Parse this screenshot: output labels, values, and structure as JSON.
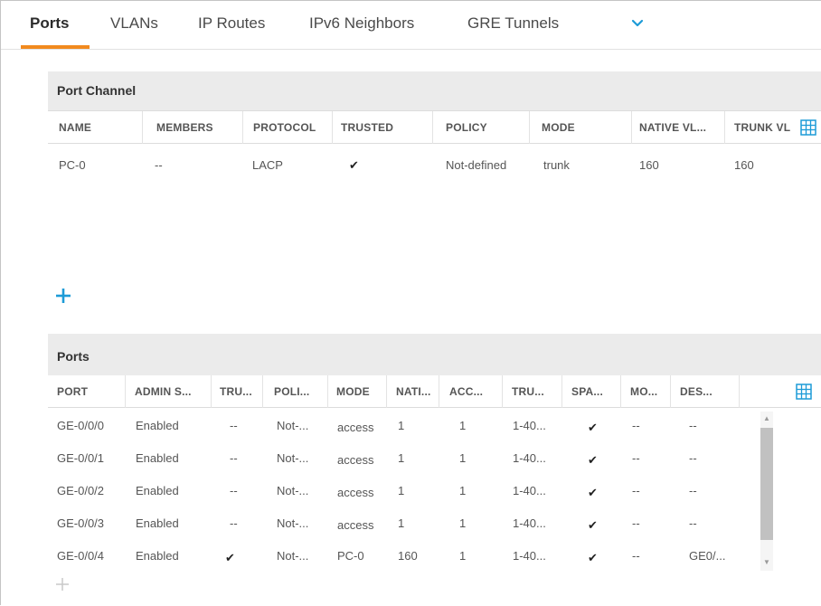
{
  "tabs": [
    {
      "label": "Ports",
      "active": true
    },
    {
      "label": "VLANs",
      "active": false
    },
    {
      "label": "IP Routes",
      "active": false
    },
    {
      "label": "IPv6 Neighbors",
      "active": false
    },
    {
      "label": "GRE Tunnels",
      "active": false
    }
  ],
  "colors": {
    "accent": "#f28a1e",
    "link_blue": "#1d9bd7",
    "header_bg": "#ebebeb"
  },
  "port_channel": {
    "title": "Port Channel",
    "columns": [
      "NAME",
      "MEMBERS",
      "PROTOCOL",
      "TRUSTED",
      "POLICY",
      "MODE",
      "NATIVE VL...",
      "TRUNK VL"
    ],
    "rows": [
      {
        "name": "PC-0",
        "members": "--",
        "protocol": "LACP",
        "trusted": "✔",
        "policy": "Not-defined",
        "mode": "trunk",
        "native_vlan": "160",
        "trunk_vlan": "160"
      }
    ],
    "add_icon": "plus-icon",
    "columns_icon": "grid-icon"
  },
  "ports": {
    "title": "Ports",
    "columns": [
      "PORT",
      "ADMIN S...",
      "TRU...",
      "POLI...",
      "MODE",
      "NATI...",
      "ACC...",
      "TRU...",
      "SPA...",
      "MO...",
      "DES..."
    ],
    "rows": [
      {
        "port": "GE-0/0/0",
        "admin": "Enabled",
        "trusted": "--",
        "policy": "Not-...",
        "mode": "access",
        "native": "1",
        "access": "1",
        "trunk": "1-40...",
        "spanning": "✔",
        "monitor": "--",
        "desc": "--"
      },
      {
        "port": "GE-0/0/1",
        "admin": "Enabled",
        "trusted": "--",
        "policy": "Not-...",
        "mode": "access",
        "native": "1",
        "access": "1",
        "trunk": "1-40...",
        "spanning": "✔",
        "monitor": "--",
        "desc": "--"
      },
      {
        "port": "GE-0/0/2",
        "admin": "Enabled",
        "trusted": "--",
        "policy": "Not-...",
        "mode": "access",
        "native": "1",
        "access": "1",
        "trunk": "1-40...",
        "spanning": "✔",
        "monitor": "--",
        "desc": "--"
      },
      {
        "port": "GE-0/0/3",
        "admin": "Enabled",
        "trusted": "--",
        "policy": "Not-...",
        "mode": "access",
        "native": "1",
        "access": "1",
        "trunk": "1-40...",
        "spanning": "✔",
        "monitor": "--",
        "desc": "--"
      },
      {
        "port": "GE-0/0/4",
        "admin": "Enabled",
        "trusted": "✔",
        "policy": "Not-...",
        "mode": "PC-0",
        "native": "160",
        "access": "1",
        "trunk": "1-40...",
        "spanning": "✔",
        "monitor": "--",
        "desc": "GE0/..."
      }
    ],
    "add_icon": "plus-icon-disabled",
    "columns_icon": "grid-icon"
  }
}
